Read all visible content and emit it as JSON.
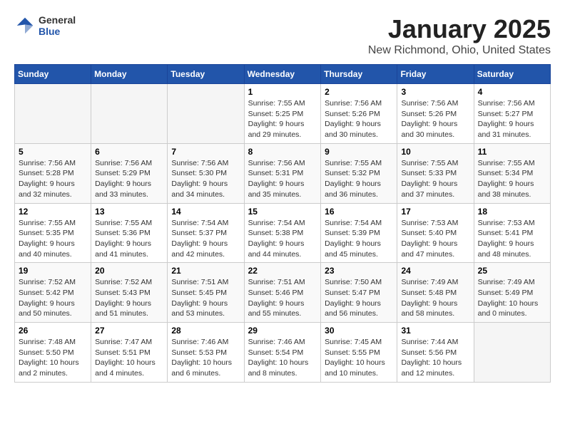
{
  "header": {
    "logo_general": "General",
    "logo_blue": "Blue",
    "month_title": "January 2025",
    "location": "New Richmond, Ohio, United States"
  },
  "days_of_week": [
    "Sunday",
    "Monday",
    "Tuesday",
    "Wednesday",
    "Thursday",
    "Friday",
    "Saturday"
  ],
  "weeks": [
    [
      {
        "day": "",
        "empty": true
      },
      {
        "day": "",
        "empty": true
      },
      {
        "day": "",
        "empty": true
      },
      {
        "day": "1",
        "sunrise": "Sunrise: 7:55 AM",
        "sunset": "Sunset: 5:25 PM",
        "daylight": "Daylight: 9 hours and 29 minutes."
      },
      {
        "day": "2",
        "sunrise": "Sunrise: 7:56 AM",
        "sunset": "Sunset: 5:26 PM",
        "daylight": "Daylight: 9 hours and 30 minutes."
      },
      {
        "day": "3",
        "sunrise": "Sunrise: 7:56 AM",
        "sunset": "Sunset: 5:26 PM",
        "daylight": "Daylight: 9 hours and 30 minutes."
      },
      {
        "day": "4",
        "sunrise": "Sunrise: 7:56 AM",
        "sunset": "Sunset: 5:27 PM",
        "daylight": "Daylight: 9 hours and 31 minutes."
      }
    ],
    [
      {
        "day": "5",
        "sunrise": "Sunrise: 7:56 AM",
        "sunset": "Sunset: 5:28 PM",
        "daylight": "Daylight: 9 hours and 32 minutes."
      },
      {
        "day": "6",
        "sunrise": "Sunrise: 7:56 AM",
        "sunset": "Sunset: 5:29 PM",
        "daylight": "Daylight: 9 hours and 33 minutes."
      },
      {
        "day": "7",
        "sunrise": "Sunrise: 7:56 AM",
        "sunset": "Sunset: 5:30 PM",
        "daylight": "Daylight: 9 hours and 34 minutes."
      },
      {
        "day": "8",
        "sunrise": "Sunrise: 7:56 AM",
        "sunset": "Sunset: 5:31 PM",
        "daylight": "Daylight: 9 hours and 35 minutes."
      },
      {
        "day": "9",
        "sunrise": "Sunrise: 7:55 AM",
        "sunset": "Sunset: 5:32 PM",
        "daylight": "Daylight: 9 hours and 36 minutes."
      },
      {
        "day": "10",
        "sunrise": "Sunrise: 7:55 AM",
        "sunset": "Sunset: 5:33 PM",
        "daylight": "Daylight: 9 hours and 37 minutes."
      },
      {
        "day": "11",
        "sunrise": "Sunrise: 7:55 AM",
        "sunset": "Sunset: 5:34 PM",
        "daylight": "Daylight: 9 hours and 38 minutes."
      }
    ],
    [
      {
        "day": "12",
        "sunrise": "Sunrise: 7:55 AM",
        "sunset": "Sunset: 5:35 PM",
        "daylight": "Daylight: 9 hours and 40 minutes."
      },
      {
        "day": "13",
        "sunrise": "Sunrise: 7:55 AM",
        "sunset": "Sunset: 5:36 PM",
        "daylight": "Daylight: 9 hours and 41 minutes."
      },
      {
        "day": "14",
        "sunrise": "Sunrise: 7:54 AM",
        "sunset": "Sunset: 5:37 PM",
        "daylight": "Daylight: 9 hours and 42 minutes."
      },
      {
        "day": "15",
        "sunrise": "Sunrise: 7:54 AM",
        "sunset": "Sunset: 5:38 PM",
        "daylight": "Daylight: 9 hours and 44 minutes."
      },
      {
        "day": "16",
        "sunrise": "Sunrise: 7:54 AM",
        "sunset": "Sunset: 5:39 PM",
        "daylight": "Daylight: 9 hours and 45 minutes."
      },
      {
        "day": "17",
        "sunrise": "Sunrise: 7:53 AM",
        "sunset": "Sunset: 5:40 PM",
        "daylight": "Daylight: 9 hours and 47 minutes."
      },
      {
        "day": "18",
        "sunrise": "Sunrise: 7:53 AM",
        "sunset": "Sunset: 5:41 PM",
        "daylight": "Daylight: 9 hours and 48 minutes."
      }
    ],
    [
      {
        "day": "19",
        "sunrise": "Sunrise: 7:52 AM",
        "sunset": "Sunset: 5:42 PM",
        "daylight": "Daylight: 9 hours and 50 minutes."
      },
      {
        "day": "20",
        "sunrise": "Sunrise: 7:52 AM",
        "sunset": "Sunset: 5:43 PM",
        "daylight": "Daylight: 9 hours and 51 minutes."
      },
      {
        "day": "21",
        "sunrise": "Sunrise: 7:51 AM",
        "sunset": "Sunset: 5:45 PM",
        "daylight": "Daylight: 9 hours and 53 minutes."
      },
      {
        "day": "22",
        "sunrise": "Sunrise: 7:51 AM",
        "sunset": "Sunset: 5:46 PM",
        "daylight": "Daylight: 9 hours and 55 minutes."
      },
      {
        "day": "23",
        "sunrise": "Sunrise: 7:50 AM",
        "sunset": "Sunset: 5:47 PM",
        "daylight": "Daylight: 9 hours and 56 minutes."
      },
      {
        "day": "24",
        "sunrise": "Sunrise: 7:49 AM",
        "sunset": "Sunset: 5:48 PM",
        "daylight": "Daylight: 9 hours and 58 minutes."
      },
      {
        "day": "25",
        "sunrise": "Sunrise: 7:49 AM",
        "sunset": "Sunset: 5:49 PM",
        "daylight": "Daylight: 10 hours and 0 minutes."
      }
    ],
    [
      {
        "day": "26",
        "sunrise": "Sunrise: 7:48 AM",
        "sunset": "Sunset: 5:50 PM",
        "daylight": "Daylight: 10 hours and 2 minutes."
      },
      {
        "day": "27",
        "sunrise": "Sunrise: 7:47 AM",
        "sunset": "Sunset: 5:51 PM",
        "daylight": "Daylight: 10 hours and 4 minutes."
      },
      {
        "day": "28",
        "sunrise": "Sunrise: 7:46 AM",
        "sunset": "Sunset: 5:53 PM",
        "daylight": "Daylight: 10 hours and 6 minutes."
      },
      {
        "day": "29",
        "sunrise": "Sunrise: 7:46 AM",
        "sunset": "Sunset: 5:54 PM",
        "daylight": "Daylight: 10 hours and 8 minutes."
      },
      {
        "day": "30",
        "sunrise": "Sunrise: 7:45 AM",
        "sunset": "Sunset: 5:55 PM",
        "daylight": "Daylight: 10 hours and 10 minutes."
      },
      {
        "day": "31",
        "sunrise": "Sunrise: 7:44 AM",
        "sunset": "Sunset: 5:56 PM",
        "daylight": "Daylight: 10 hours and 12 minutes."
      },
      {
        "day": "",
        "empty": true
      }
    ]
  ]
}
